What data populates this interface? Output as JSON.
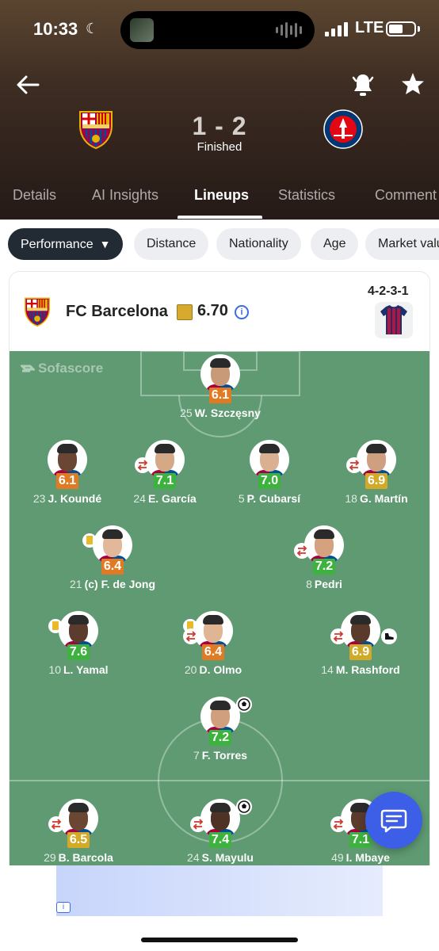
{
  "status_bar": {
    "time": "10:33",
    "network": "LTE"
  },
  "match": {
    "score": "1 - 2",
    "status": "Finished"
  },
  "tabs": [
    {
      "label": "Details",
      "active": false
    },
    {
      "label": "AI Insights",
      "active": false
    },
    {
      "label": "Lineups",
      "active": true
    },
    {
      "label": "Statistics",
      "active": false
    },
    {
      "label": "Comment",
      "active": false
    }
  ],
  "filters": [
    {
      "label": "Performance",
      "active": true
    },
    {
      "label": "Distance",
      "active": false
    },
    {
      "label": "Nationality",
      "active": false
    },
    {
      "label": "Age",
      "active": false
    },
    {
      "label": "Market valu",
      "active": false
    }
  ],
  "team": {
    "name": "FC Barcelona",
    "rating": "6.70",
    "formation": "4-2-3-1"
  },
  "watermark": "Sofascore",
  "colors": {
    "rating_orange": "#e07b23",
    "rating_green": "#3db23f",
    "rating_yellow": "#d3a928",
    "pitch": "#5f9a72",
    "accent": "#3d5ee6"
  },
  "players": [
    {
      "num": "25",
      "name": "W. Szczęsny",
      "rating": "6.1",
      "grade": "orange",
      "events": []
    },
    {
      "num": "23",
      "name": "J. Koundé",
      "rating": "6.1",
      "grade": "orange",
      "events": []
    },
    {
      "num": "24",
      "name": "E. García",
      "rating": "7.1",
      "grade": "green",
      "events": [
        "sub-out"
      ]
    },
    {
      "num": "5",
      "name": "P. Cubarsí",
      "rating": "7.0",
      "grade": "green",
      "events": []
    },
    {
      "num": "18",
      "name": "G. Martín",
      "rating": "6.9",
      "grade": "yellow",
      "events": [
        "sub"
      ]
    },
    {
      "num": "21",
      "name": "(c) F. de Jong",
      "rating": "6.4",
      "grade": "orange",
      "events": [
        "yellow-card"
      ]
    },
    {
      "num": "8",
      "name": "Pedri",
      "rating": "7.2",
      "grade": "green",
      "events": [
        "sub"
      ]
    },
    {
      "num": "10",
      "name": "L. Yamal",
      "rating": "7.6",
      "grade": "green",
      "events": [
        "yellow-card"
      ]
    },
    {
      "num": "20",
      "name": "D. Olmo",
      "rating": "6.4",
      "grade": "orange",
      "events": [
        "yellow-card",
        "sub"
      ]
    },
    {
      "num": "14",
      "name": "M. Rashford",
      "rating": "6.9",
      "grade": "yellow",
      "events": [
        "sub",
        "assist"
      ]
    },
    {
      "num": "7",
      "name": "F. Torres",
      "rating": "7.2",
      "grade": "green",
      "events": [
        "goal"
      ]
    },
    {
      "num": "29",
      "name": "B. Barcola",
      "rating": "6.5",
      "grade": "yellow",
      "events": [
        "sub"
      ]
    },
    {
      "num": "24",
      "name": "S. Mayulu",
      "rating": "7.4",
      "grade": "green",
      "events": [
        "sub",
        "goal"
      ]
    },
    {
      "num": "49",
      "name": "I. Mbaye",
      "rating": "7.1",
      "grade": "green",
      "events": [
        "sub"
      ]
    }
  ]
}
